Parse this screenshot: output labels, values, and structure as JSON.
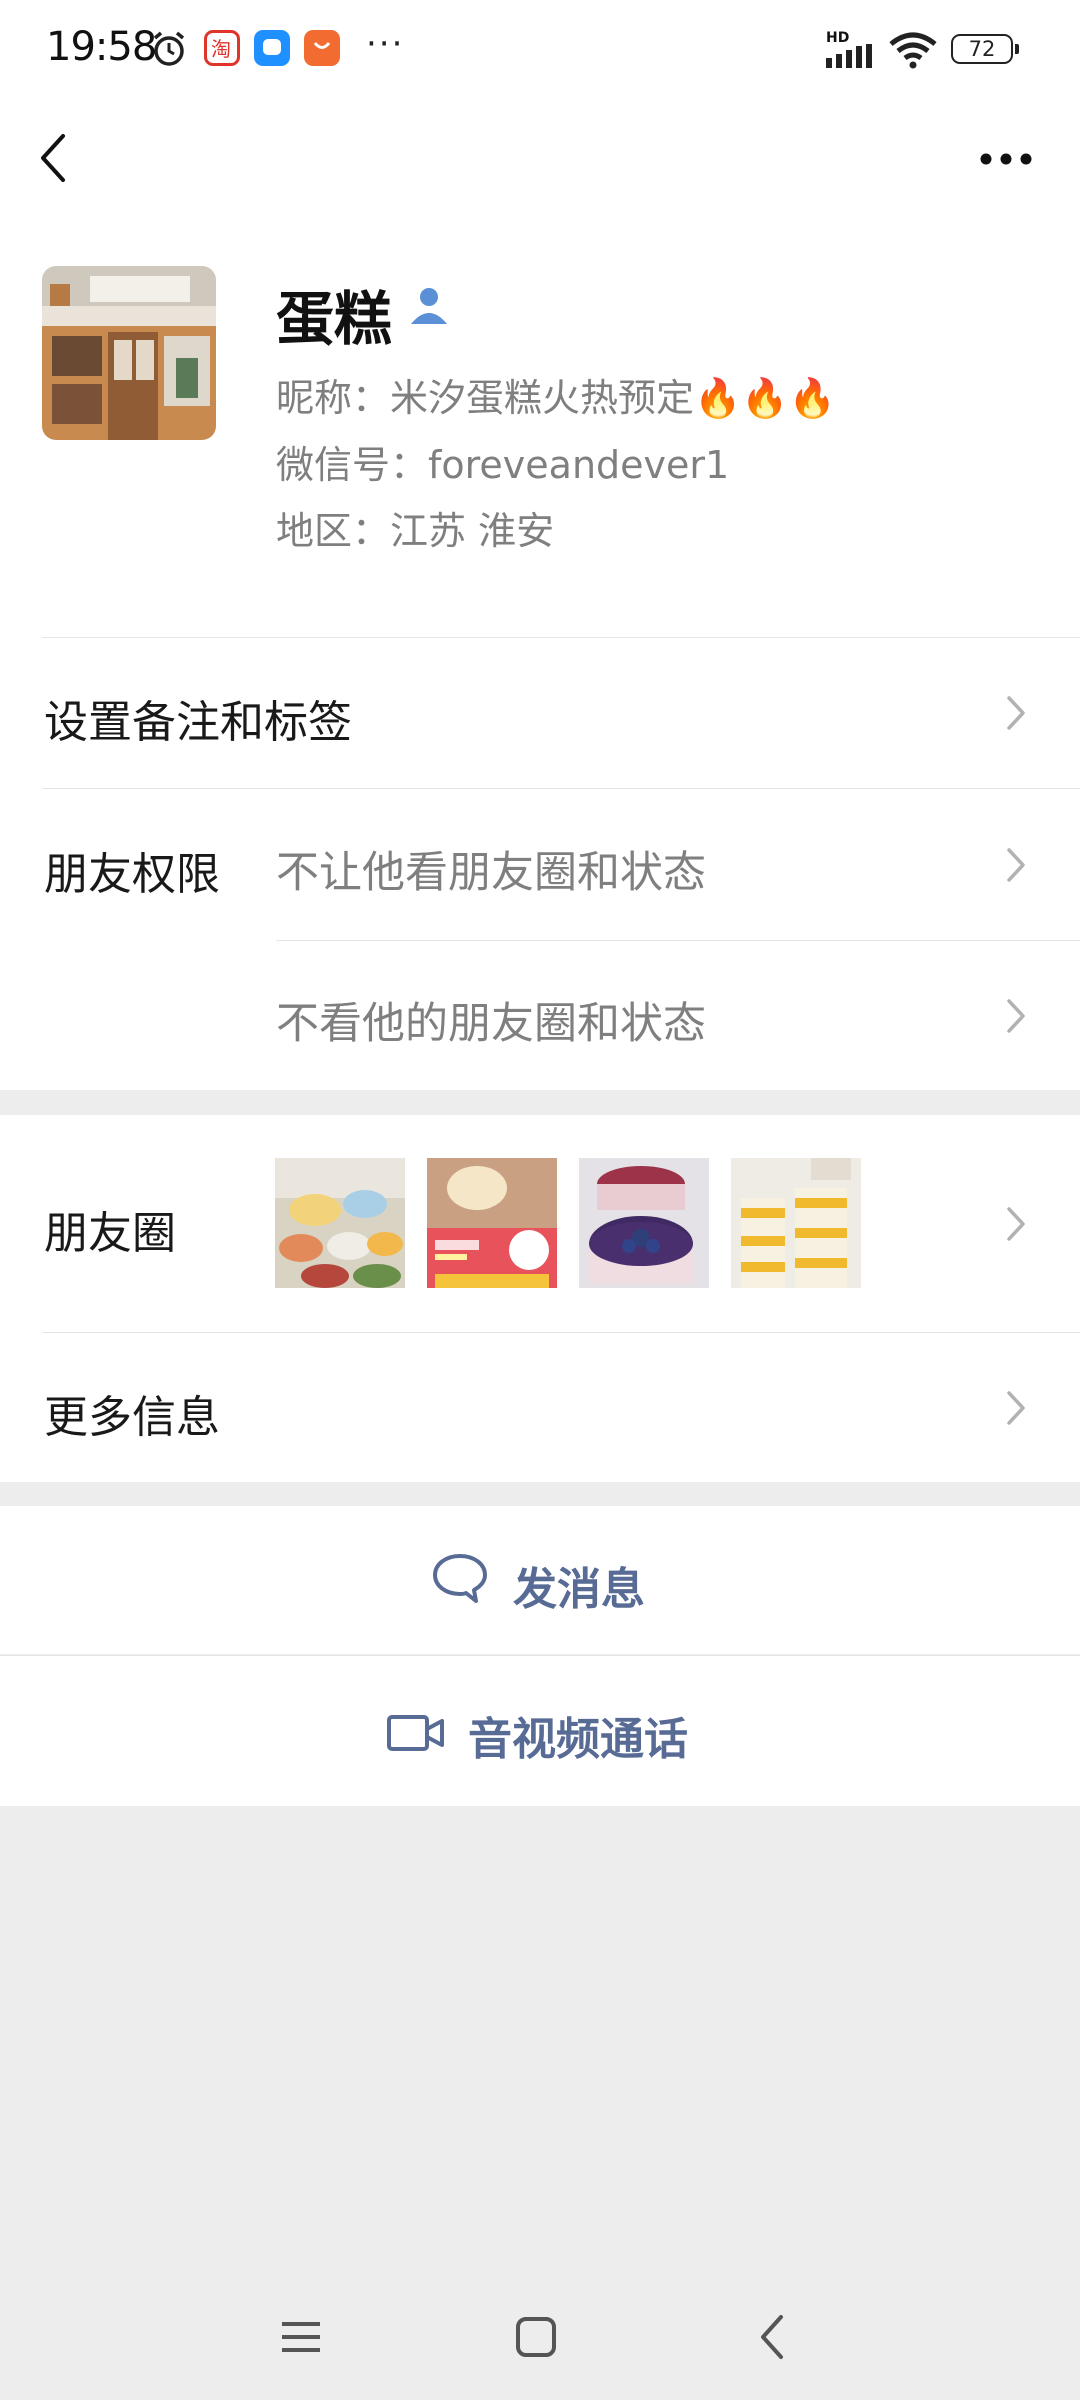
{
  "status_bar": {
    "time": "19:58",
    "battery": "72",
    "more": "···",
    "network": "HD",
    "icons": [
      "alarm-icon",
      "taobao-icon",
      "chat-app-icon",
      "shop-app-icon",
      "signal-icon",
      "wifi-icon",
      "battery-icon"
    ]
  },
  "header": {
    "back_icon": "back-icon",
    "more_icon": "more-icon"
  },
  "profile": {
    "name": "蛋糕",
    "nickname": "昵称：米汐蛋糕火热预定🔥🔥🔥",
    "wechat_id": "微信号：foreveandever1",
    "region": "地区：江苏  淮安"
  },
  "rows": {
    "remark": "设置备注和标签",
    "permission_label": "朋友权限",
    "permission_1": "不让他看朋友圈和状态",
    "permission_2": "不看他的朋友圈和状态",
    "moments_label": "朋友圈",
    "more_info": "更多信息"
  },
  "actions": {
    "message": "发消息",
    "call": "音视频通话"
  },
  "colors": {
    "link": "#576b95",
    "background": "#ededed",
    "secondary_text": "#7f7f7f"
  }
}
